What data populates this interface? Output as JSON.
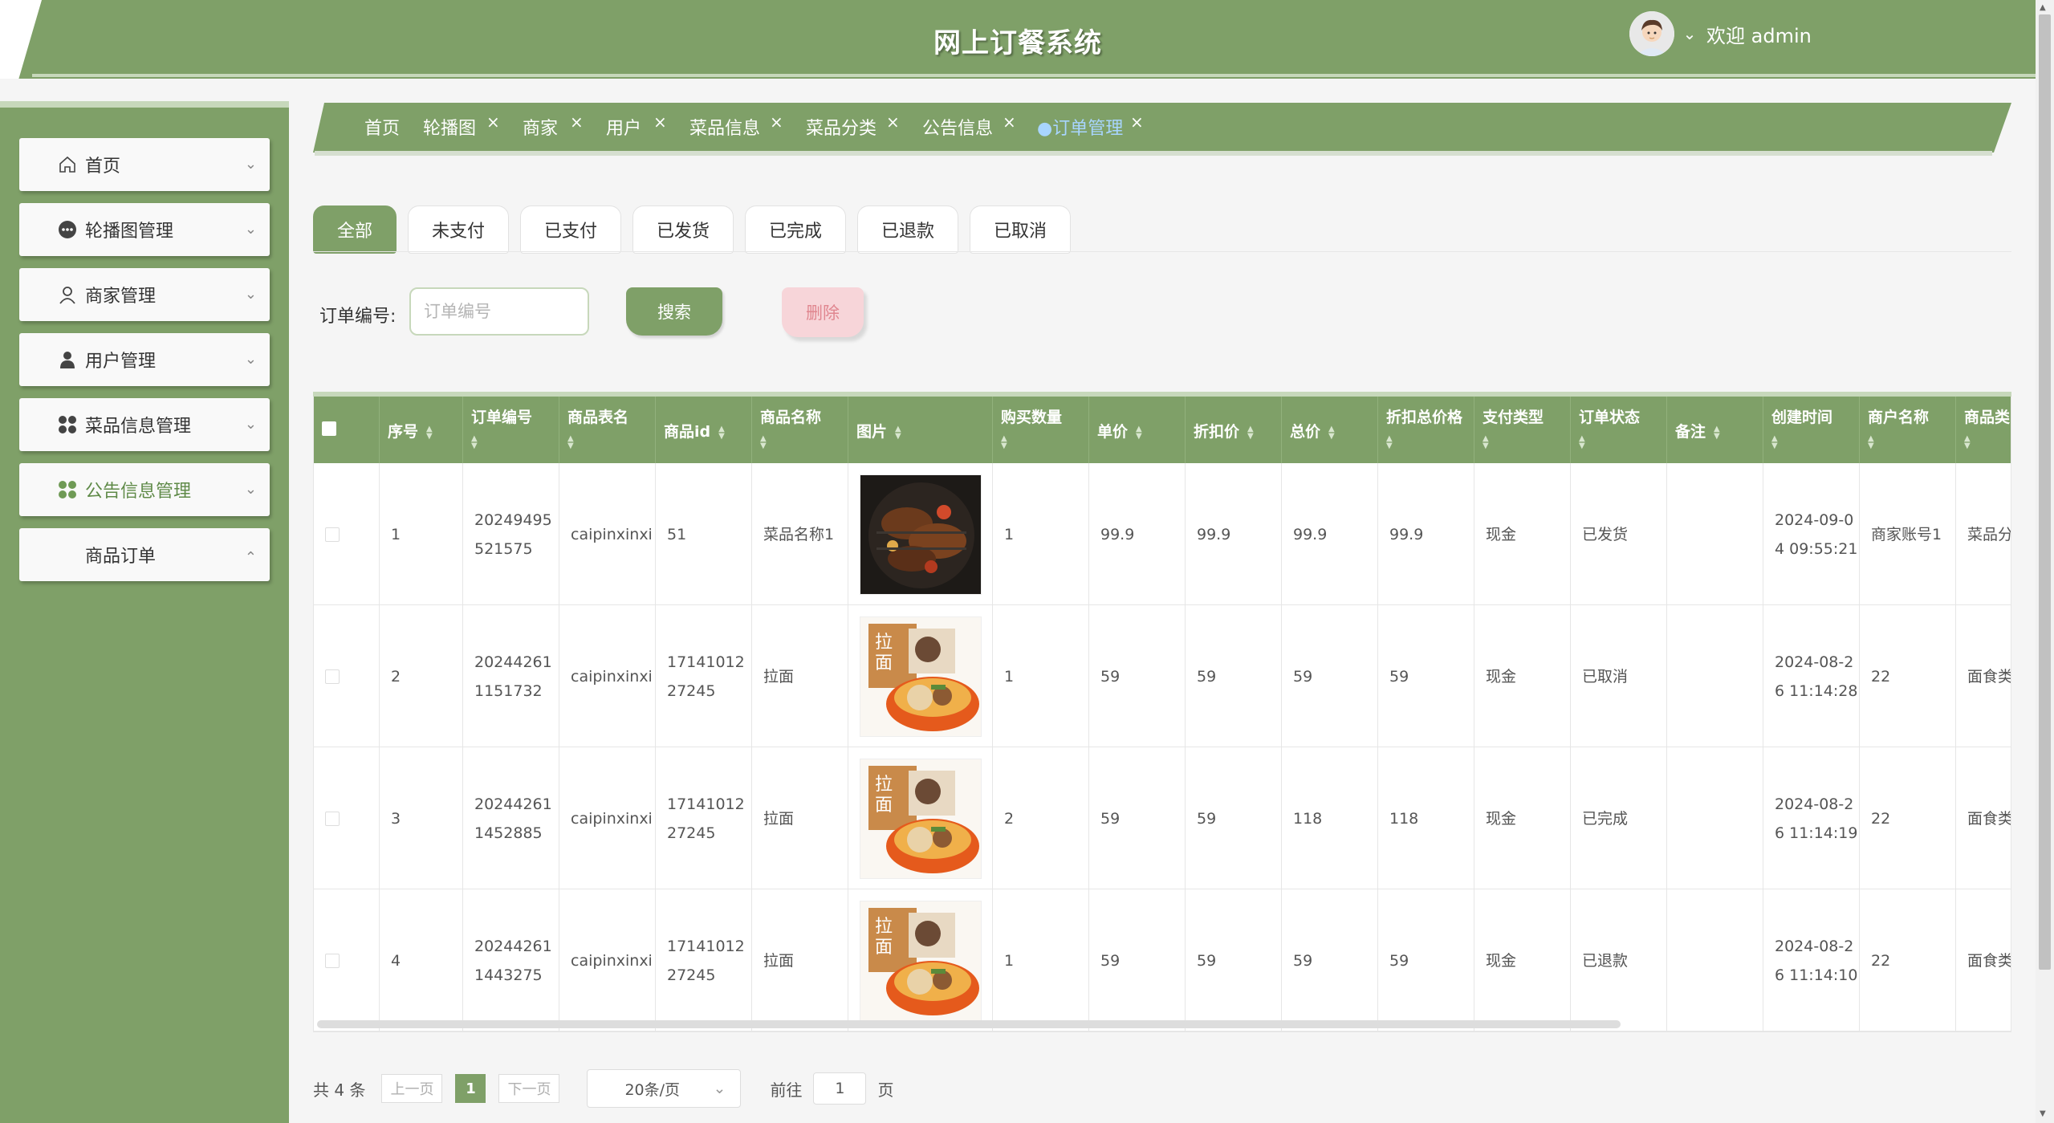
{
  "header": {
    "title": "网上订餐系统",
    "welcome": "欢迎 admin"
  },
  "sidebar": {
    "items": [
      {
        "label": "首页",
        "icon": "home-icon",
        "expanded": false
      },
      {
        "label": "轮播图管理",
        "icon": "carousel-icon",
        "expanded": false
      },
      {
        "label": "商家管理",
        "icon": "person-icon",
        "expanded": false
      },
      {
        "label": "用户管理",
        "icon": "user-icon",
        "expanded": false
      },
      {
        "label": "菜品信息管理",
        "icon": "grid-icon",
        "expanded": false
      },
      {
        "label": "公告信息管理",
        "icon": "grid-icon",
        "expanded": false
      },
      {
        "label": "商品订单",
        "icon": "",
        "expanded": true
      }
    ]
  },
  "tabs": [
    {
      "label": "首页",
      "closable": false
    },
    {
      "label": "轮播图",
      "closable": true
    },
    {
      "label": "商家",
      "closable": true
    },
    {
      "label": "用户",
      "closable": true
    },
    {
      "label": "菜品信息",
      "closable": true
    },
    {
      "label": "菜品分类",
      "closable": true
    },
    {
      "label": "公告信息",
      "closable": true
    },
    {
      "label": "●订单管理",
      "closable": true,
      "active": true
    }
  ],
  "status_filters": [
    "全部",
    "未支付",
    "已支付",
    "已发货",
    "已完成",
    "已退款",
    "已取消"
  ],
  "status_active": "全部",
  "search": {
    "label": "订单编号:",
    "placeholder": "订单编号",
    "search_button": "搜索",
    "delete_button": "删除"
  },
  "table": {
    "headers": [
      "序号",
      "订单编号",
      "商品表名",
      "商品id",
      "商品名称",
      "图片",
      "购买数量",
      "单价",
      "折扣价",
      "总价",
      "折扣总价格",
      "支付类型",
      "订单状态",
      "备注",
      "创建时间",
      "商户名称",
      "商品类"
    ],
    "rows": [
      [
        "1",
        "20249495521575",
        "caipinxinxi",
        "51",
        "菜品名称1",
        "",
        "1",
        "99.9",
        "99.9",
        "99.9",
        "99.9",
        "现金",
        "已发货",
        "",
        "2024-09-04 09:55:21",
        "商家账号1",
        "菜品分"
      ],
      [
        "2",
        "202442611151732",
        "caipinxinxi",
        "1714101227245",
        "拉面",
        "",
        "1",
        "59",
        "59",
        "59",
        "59",
        "现金",
        "已取消",
        "",
        "2024-08-26 11:14:28",
        "22",
        "面食类"
      ],
      [
        "3",
        "202442611452885",
        "caipinxinxi",
        "1714101227245",
        "拉面",
        "",
        "2",
        "59",
        "59",
        "118",
        "118",
        "现金",
        "已完成",
        "",
        "2024-08-26 11:14:19",
        "22",
        "面食类"
      ],
      [
        "4",
        "202442611443275",
        "caipinxinxi",
        "1714101227245",
        "拉面",
        "",
        "1",
        "59",
        "59",
        "59",
        "59",
        "现金",
        "已退款",
        "",
        "2024-08-26 11:14:10",
        "22",
        "面食类"
      ]
    ],
    "image_icons": [
      "grilled-meat-image",
      "ramen-image",
      "ramen-image",
      "ramen-image"
    ]
  },
  "pagination": {
    "total": "共 4 条",
    "prev": "上一页",
    "next": "下一页",
    "current": "1",
    "page_size": "20条/页",
    "goto_prefix": "前往",
    "goto_value": "1",
    "goto_suffix": "页"
  },
  "colors": {
    "primary": "#7fa068",
    "accent_light": "#c7d8bb",
    "delete_bg": "#f7d5d9",
    "delete_text": "#e0868f"
  }
}
